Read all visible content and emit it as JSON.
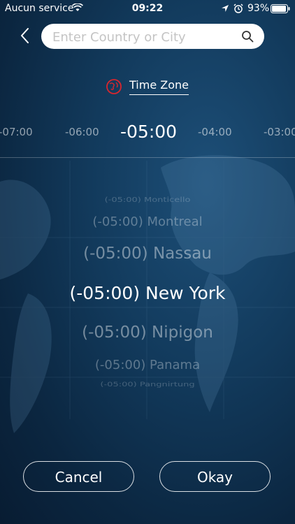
{
  "status_bar": {
    "carrier": "Aucun service",
    "time": "09:22",
    "battery": "93%"
  },
  "search": {
    "placeholder": "Enter Country or City",
    "value": ""
  },
  "tab": {
    "label": "Time Zone"
  },
  "offsets": [
    "-07:00",
    "-06:00",
    "-05:00",
    "-04:00",
    "-03:00"
  ],
  "selected_offset": "-05:00",
  "cities": [
    "(-05:00) Monticello",
    "(-05:00) Montreal",
    "(-05:00) Nassau",
    "(-05:00) New York",
    "(-05:00) Nipigon",
    "(-05:00) Panama",
    "(-05:00) Pangnirtung"
  ],
  "selected_city": "(-05:00) New York",
  "buttons": {
    "cancel": "Cancel",
    "okay": "Okay"
  },
  "colors": {
    "background": "#0b2640",
    "accent_icon": "#d8262e"
  }
}
